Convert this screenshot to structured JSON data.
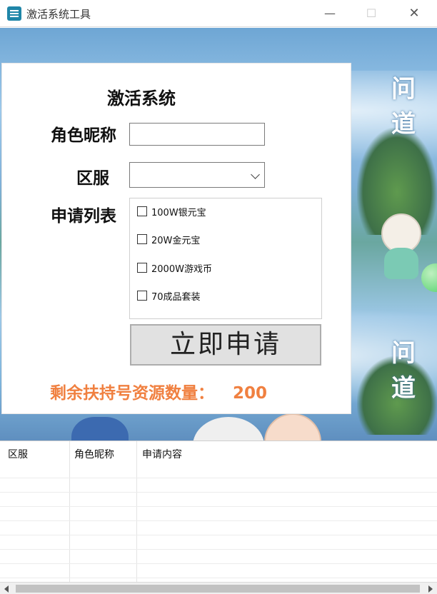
{
  "window": {
    "title": "激活系统工具",
    "minimize_glyph": "—",
    "maximize_glyph": "☐",
    "close_glyph": "✕"
  },
  "banner": {
    "logo_text": "问道",
    "icons": [
      "app-icon",
      "chevron-down-icon",
      "checkbox-icon"
    ]
  },
  "form": {
    "title": "激活系统",
    "name_label": "角色昵称",
    "name_value": "",
    "server_label": "区服",
    "server_value": "",
    "list_label": "申请列表",
    "options": [
      {
        "label": "100W银元宝",
        "checked": false
      },
      {
        "label": "20W金元宝",
        "checked": false
      },
      {
        "label": "2000W游戏币",
        "checked": false
      },
      {
        "label": "70成品套装",
        "checked": false
      }
    ],
    "submit_label": "立即申请",
    "remaining_label": "剩余扶持号资源数量：",
    "remaining_value": "200"
  },
  "table": {
    "columns": [
      "区服",
      "角色昵称",
      "申请内容"
    ],
    "rows": []
  },
  "colors": {
    "accent_orange": "#f08040",
    "button_gray": "#e1e1e1"
  }
}
